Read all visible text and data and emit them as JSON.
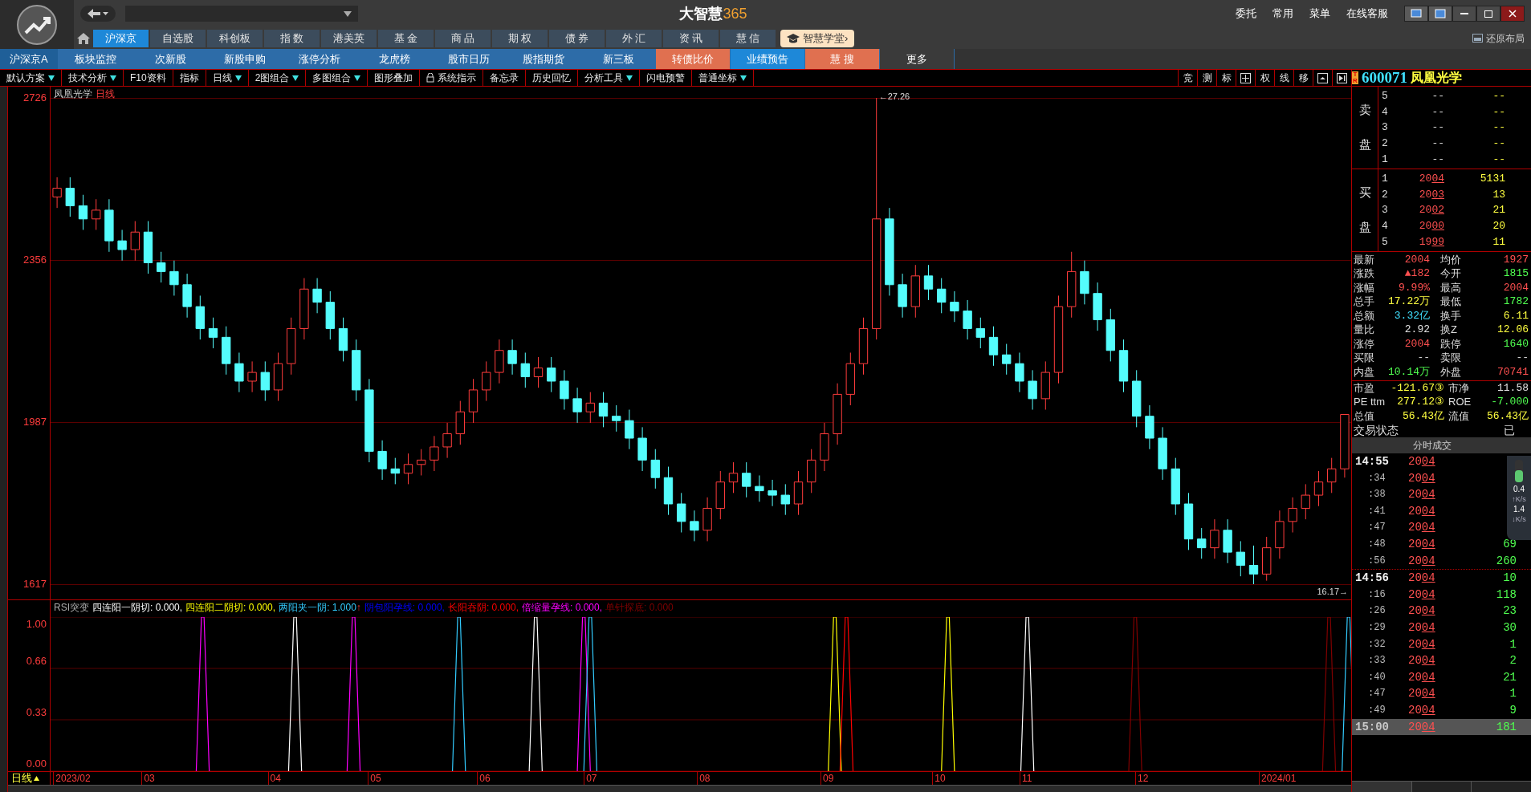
{
  "app": {
    "title": "大智慧",
    "title_accent": "365"
  },
  "top_menu": [
    "委托",
    "常用",
    "菜单",
    "在线客服"
  ],
  "nav_tabs": [
    {
      "label": "沪深京",
      "selected": true
    },
    {
      "label": "自选股",
      "selected": false
    },
    {
      "label": "科创板",
      "selected": false
    },
    {
      "label": "指 数",
      "selected": false
    },
    {
      "label": "港美英",
      "selected": false
    },
    {
      "label": "基 金",
      "selected": false
    },
    {
      "label": "商 品",
      "selected": false
    },
    {
      "label": "期 权",
      "selected": false
    },
    {
      "label": "债 券",
      "selected": false
    },
    {
      "label": "外 汇",
      "selected": false
    },
    {
      "label": "资 讯",
      "selected": false
    },
    {
      "label": "慧 信",
      "selected": false
    }
  ],
  "academy_button": "智慧学堂›",
  "restore_layout": "还原布局",
  "subnav": [
    {
      "label": "沪深京A",
      "kind": "title"
    },
    {
      "label": "板块监控",
      "kind": "plain"
    },
    {
      "label": "次新股",
      "kind": "plain"
    },
    {
      "label": "新股申购",
      "kind": "plain"
    },
    {
      "label": "涨停分析",
      "kind": "plain"
    },
    {
      "label": "龙虎榜",
      "kind": "plain"
    },
    {
      "label": "股市日历",
      "kind": "plain"
    },
    {
      "label": "股指期货",
      "kind": "plain"
    },
    {
      "label": "新三板",
      "kind": "plain"
    },
    {
      "label": "转债比价",
      "kind": "hot"
    },
    {
      "label": "业绩预告",
      "kind": "accent"
    },
    {
      "label": "慧 搜",
      "kind": "hot"
    },
    {
      "label": "更多",
      "kind": "dark"
    }
  ],
  "toolbar": [
    {
      "label": "默认方案",
      "dropdown": true
    },
    {
      "label": "技术分析",
      "dropdown": true
    },
    {
      "label": "F10资料",
      "dropdown": false
    },
    {
      "label": "指标",
      "dropdown": false
    },
    {
      "label": "日线",
      "dropdown": true
    },
    {
      "label": "2图组合",
      "dropdown": true
    },
    {
      "label": "多图组合",
      "dropdown": true
    },
    {
      "label": "图形叠加",
      "dropdown": false
    },
    {
      "label": "系统指示",
      "dropdown": false,
      "locked": true
    },
    {
      "label": "备忘录",
      "dropdown": false
    },
    {
      "label": "历史回忆",
      "dropdown": false
    },
    {
      "label": "分析工具",
      "dropdown": true
    },
    {
      "label": "闪电预警",
      "dropdown": false
    },
    {
      "label": "普通坐标",
      "dropdown": true
    }
  ],
  "toolbar_right": [
    {
      "kind": "text",
      "label": "竞"
    },
    {
      "kind": "text",
      "label": "测"
    },
    {
      "kind": "text",
      "label": "标"
    },
    {
      "kind": "grid"
    },
    {
      "kind": "text",
      "label": "权"
    },
    {
      "kind": "text",
      "label": "线"
    },
    {
      "kind": "text",
      "label": "移"
    },
    {
      "kind": "panel"
    },
    {
      "kind": "play"
    }
  ],
  "stock": {
    "badge": "TR",
    "code": "600071",
    "name": "凤凰光学"
  },
  "chart": {
    "title": "凤凰光学",
    "period": "日线",
    "high_note": "←27.26",
    "low_note": "16.17→",
    "chart_data": {
      "type": "candlestick",
      "ylim": [
        1617,
        2726
      ],
      "yticks": [
        2726,
        2356,
        1987,
        1617
      ],
      "ohlc": [
        [
          2500,
          2545,
          2475,
          2520
        ],
        [
          2520,
          2545,
          2455,
          2480
        ],
        [
          2480,
          2505,
          2425,
          2450
        ],
        [
          2450,
          2495,
          2425,
          2470
        ],
        [
          2470,
          2495,
          2375,
          2400
        ],
        [
          2400,
          2425,
          2355,
          2380
        ],
        [
          2380,
          2445,
          2355,
          2420
        ],
        [
          2420,
          2445,
          2325,
          2350
        ],
        [
          2350,
          2375,
          2305,
          2330
        ],
        [
          2330,
          2355,
          2275,
          2300
        ],
        [
          2300,
          2325,
          2225,
          2250
        ],
        [
          2250,
          2275,
          2175,
          2200
        ],
        [
          2200,
          2225,
          2155,
          2180
        ],
        [
          2180,
          2205,
          2095,
          2120
        ],
        [
          2120,
          2145,
          2055,
          2080
        ],
        [
          2080,
          2125,
          2055,
          2100
        ],
        [
          2100,
          2125,
          2035,
          2060
        ],
        [
          2060,
          2145,
          2035,
          2120
        ],
        [
          2120,
          2225,
          2095,
          2200
        ],
        [
          2200,
          2315,
          2175,
          2290
        ],
        [
          2290,
          2315,
          2235,
          2260
        ],
        [
          2260,
          2285,
          2175,
          2200
        ],
        [
          2200,
          2225,
          2125,
          2150
        ],
        [
          2150,
          2175,
          2035,
          2060
        ],
        [
          2060,
          2085,
          1895,
          1920
        ],
        [
          1920,
          1945,
          1855,
          1880
        ],
        [
          1880,
          1905,
          1845,
          1870
        ],
        [
          1870,
          1915,
          1845,
          1890
        ],
        [
          1890,
          1925,
          1865,
          1900
        ],
        [
          1900,
          1955,
          1875,
          1930
        ],
        [
          1930,
          1985,
          1905,
          1960
        ],
        [
          1960,
          2035,
          1935,
          2010
        ],
        [
          2010,
          2085,
          1985,
          2060
        ],
        [
          2060,
          2125,
          2035,
          2100
        ],
        [
          2100,
          2175,
          2075,
          2150
        ],
        [
          2150,
          2175,
          2095,
          2120
        ],
        [
          2120,
          2145,
          2065,
          2090
        ],
        [
          2090,
          2135,
          2065,
          2110
        ],
        [
          2110,
          2135,
          2055,
          2080
        ],
        [
          2080,
          2105,
          2015,
          2040
        ],
        [
          2040,
          2065,
          1985,
          2010
        ],
        [
          2010,
          2055,
          1985,
          2030
        ],
        [
          2030,
          2055,
          1975,
          2000
        ],
        [
          2000,
          2025,
          1965,
          1990
        ],
        [
          1990,
          2015,
          1925,
          1950
        ],
        [
          1950,
          1975,
          1875,
          1900
        ],
        [
          1900,
          1925,
          1835,
          1860
        ],
        [
          1860,
          1885,
          1775,
          1800
        ],
        [
          1800,
          1825,
          1735,
          1760
        ],
        [
          1760,
          1785,
          1715,
          1740
        ],
        [
          1740,
          1815,
          1715,
          1790
        ],
        [
          1790,
          1875,
          1765,
          1850
        ],
        [
          1850,
          1895,
          1825,
          1870
        ],
        [
          1870,
          1895,
          1815,
          1840
        ],
        [
          1840,
          1865,
          1805,
          1830
        ],
        [
          1830,
          1855,
          1795,
          1820
        ],
        [
          1820,
          1845,
          1775,
          1800
        ],
        [
          1800,
          1875,
          1775,
          1850
        ],
        [
          1850,
          1925,
          1825,
          1900
        ],
        [
          1900,
          1985,
          1875,
          1960
        ],
        [
          1960,
          2075,
          1935,
          2050
        ],
        [
          2050,
          2145,
          2025,
          2120
        ],
        [
          2120,
          2225,
          2095,
          2200
        ],
        [
          2200,
          2726,
          2175,
          2450
        ],
        [
          2450,
          2475,
          2275,
          2300
        ],
        [
          2300,
          2325,
          2225,
          2250
        ],
        [
          2250,
          2345,
          2225,
          2320
        ],
        [
          2320,
          2345,
          2265,
          2290
        ],
        [
          2290,
          2315,
          2235,
          2260
        ],
        [
          2260,
          2285,
          2215,
          2240
        ],
        [
          2240,
          2265,
          2175,
          2200
        ],
        [
          2200,
          2225,
          2155,
          2180
        ],
        [
          2180,
          2205,
          2115,
          2140
        ],
        [
          2140,
          2165,
          2095,
          2120
        ],
        [
          2120,
          2145,
          2055,
          2080
        ],
        [
          2080,
          2105,
          2015,
          2040
        ],
        [
          2040,
          2125,
          2015,
          2100
        ],
        [
          2100,
          2275,
          2075,
          2250
        ],
        [
          2250,
          2375,
          2225,
          2330
        ],
        [
          2330,
          2355,
          2255,
          2280
        ],
        [
          2280,
          2305,
          2195,
          2220
        ],
        [
          2220,
          2245,
          2125,
          2150
        ],
        [
          2150,
          2175,
          2055,
          2080
        ],
        [
          2080,
          2105,
          1975,
          2000
        ],
        [
          2000,
          2025,
          1925,
          1950
        ],
        [
          1950,
          1975,
          1855,
          1880
        ],
        [
          1880,
          1905,
          1775,
          1800
        ],
        [
          1800,
          1825,
          1695,
          1720
        ],
        [
          1720,
          1745,
          1675,
          1700
        ],
        [
          1700,
          1765,
          1675,
          1740
        ],
        [
          1740,
          1765,
          1665,
          1690
        ],
        [
          1690,
          1715,
          1635,
          1660
        ],
        [
          1660,
          1705,
          1617,
          1640
        ],
        [
          1640,
          1725,
          1625,
          1700
        ],
        [
          1700,
          1785,
          1675,
          1760
        ],
        [
          1760,
          1815,
          1735,
          1790
        ],
        [
          1790,
          1845,
          1765,
          1820
        ],
        [
          1820,
          1875,
          1795,
          1850
        ],
        [
          1850,
          1905,
          1825,
          1880
        ],
        [
          1880,
          2004,
          1860,
          2004
        ]
      ]
    }
  },
  "indicator": {
    "name": "RSI突变",
    "axis_labels": [
      "1.00",
      "0.66",
      "0.33",
      "0.00"
    ],
    "items": [
      {
        "label": "四连阳一阴切:",
        "value": "0.000,",
        "color": "#ffffff"
      },
      {
        "label": "四连阳二阴切:",
        "value": "0.000,",
        "color": "#ffff00"
      },
      {
        "label": "两阳夹一阴:",
        "value": "1.000",
        "color": "#33ccff",
        "mark": "↑"
      },
      {
        "label": "阴包阳孕线:",
        "value": "0.000,",
        "color": "#0000ff"
      },
      {
        "label": "长阳吞阴:",
        "value": "0.000,",
        "color": "#ff0000"
      },
      {
        "label": "倍缩量孕线:",
        "value": "0.000,",
        "color": "#ff00ff"
      },
      {
        "label": "单针探底:",
        "value": "0.000",
        "color": "#800000"
      }
    ]
  },
  "dates": {
    "period": "日线",
    "labels": [
      "2023/02",
      "03",
      "04",
      "05",
      "06",
      "07",
      "08",
      "09",
      "10",
      "11",
      "12",
      "2024/01"
    ]
  },
  "order_book": {
    "sell_label": [
      "卖",
      "盘"
    ],
    "buy_label": [
      "买",
      "盘"
    ],
    "sell": [
      {
        "level": "5",
        "price": "--",
        "volume": "--"
      },
      {
        "level": "4",
        "price": "--",
        "volume": "--"
      },
      {
        "level": "3",
        "price": "--",
        "volume": "--"
      },
      {
        "level": "2",
        "price": "--",
        "volume": "--"
      },
      {
        "level": "1",
        "price": "--",
        "volume": "--"
      }
    ],
    "buy": [
      {
        "level": "1",
        "price": "2004",
        "volume": "5131"
      },
      {
        "level": "2",
        "price": "2003",
        "volume": "13"
      },
      {
        "level": "3",
        "price": "2002",
        "volume": "21"
      },
      {
        "level": "4",
        "price": "2000",
        "volume": "20"
      },
      {
        "level": "5",
        "price": "1999",
        "volume": "11"
      }
    ]
  },
  "quote": [
    {
      "label": "最新",
      "value": "2004",
      "color": "#ff5050"
    },
    {
      "label": "均价",
      "value": "1927",
      "color": "#ff5050"
    },
    {
      "label": "涨跌",
      "value": "▲182",
      "color": "#ff5050"
    },
    {
      "label": "今开",
      "value": "1815",
      "color": "#50ff50"
    },
    {
      "label": "涨幅",
      "value": "9.99%",
      "color": "#ff5050"
    },
    {
      "label": "最高",
      "value": "2004",
      "color": "#ff5050"
    },
    {
      "label": "总手",
      "value": "17.22万",
      "color": "#ffff40"
    },
    {
      "label": "最低",
      "value": "1782",
      "color": "#50ff50"
    },
    {
      "label": "总额",
      "value": "3.32亿",
      "color": "#40e0ff"
    },
    {
      "label": "换手",
      "value": "6.11",
      "color": "#ffff40"
    },
    {
      "label": "量比",
      "value": "2.92",
      "color": "#e0e0e0"
    },
    {
      "label": "换Z",
      "value": "12.06",
      "color": "#ffff40"
    },
    {
      "label": "涨停",
      "value": "2004",
      "color": "#ff5050"
    },
    {
      "label": "跌停",
      "value": "1640",
      "color": "#50ff50"
    },
    {
      "label": "买限",
      "value": "--"
    },
    {
      "label": "卖限",
      "value": "--"
    },
    {
      "label": "内盘",
      "value": "10.14万",
      "color": "#50ff50"
    },
    {
      "label": "外盘",
      "value": "70741",
      "color": "#ff5050"
    }
  ],
  "valuation": [
    {
      "label": "市盈",
      "value": "-121.67③",
      "color": "#ffff40"
    },
    {
      "label": "市净",
      "value": "11.58",
      "color": "#e0e0e0"
    },
    {
      "label": "PE ttm",
      "value": "277.12③",
      "color": "#ffff40"
    },
    {
      "label": "ROE",
      "value": "-7.000",
      "color": "#50ff50"
    },
    {
      "label": "总值",
      "value": "56.43亿",
      "color": "#ffff40"
    },
    {
      "label": "流值",
      "value": "56.43亿",
      "color": "#ffff40"
    }
  ],
  "status": {
    "label": "交易状态",
    "value": "已"
  },
  "ticks": {
    "title": "分时成交",
    "rows": [
      {
        "time": "14:55",
        "price": "2004",
        "major": true,
        "selected": false
      },
      {
        "time": ":34",
        "price": "2004",
        "major": false,
        "selected": false
      },
      {
        "time": ":38",
        "price": "2004",
        "major": false,
        "selected": false
      },
      {
        "time": ":41",
        "price": "2004",
        "major": false,
        "selected": false
      },
      {
        "time": ":47",
        "price": "2004",
        "major": false,
        "selected": false
      },
      {
        "time": ":48",
        "price": "2004",
        "volume": "69",
        "major": false,
        "selected": false
      },
      {
        "time": ":56",
        "price": "2004",
        "volume": "260",
        "major": false,
        "selected": false
      },
      {
        "time": "14:56",
        "price": "2004",
        "volume": "10",
        "major": true,
        "selected": false
      },
      {
        "time": ":16",
        "price": "2004",
        "volume": "118",
        "major": false,
        "selected": false
      },
      {
        "time": ":26",
        "price": "2004",
        "volume": "23",
        "major": false,
        "selected": false
      },
      {
        "time": ":29",
        "price": "2004",
        "volume": "30",
        "major": false,
        "selected": false
      },
      {
        "time": ":32",
        "price": "2004",
        "volume": "1",
        "major": false,
        "selected": false
      },
      {
        "time": ":33",
        "price": "2004",
        "volume": "2",
        "major": false,
        "selected": false
      },
      {
        "time": ":40",
        "price": "2004",
        "volume": "21",
        "major": false,
        "selected": false
      },
      {
        "time": ":47",
        "price": "2004",
        "volume": "1",
        "major": false,
        "selected": false
      },
      {
        "time": ":49",
        "price": "2004",
        "volume": "9",
        "major": false,
        "selected": false
      },
      {
        "time": "15:00",
        "price": "2004",
        "volume": "181",
        "major": true,
        "selected": true
      }
    ]
  },
  "speed": {
    "up": "0.4",
    "up_unit": "↑K/s",
    "down": "1.4",
    "down_unit": "↓K/s"
  }
}
